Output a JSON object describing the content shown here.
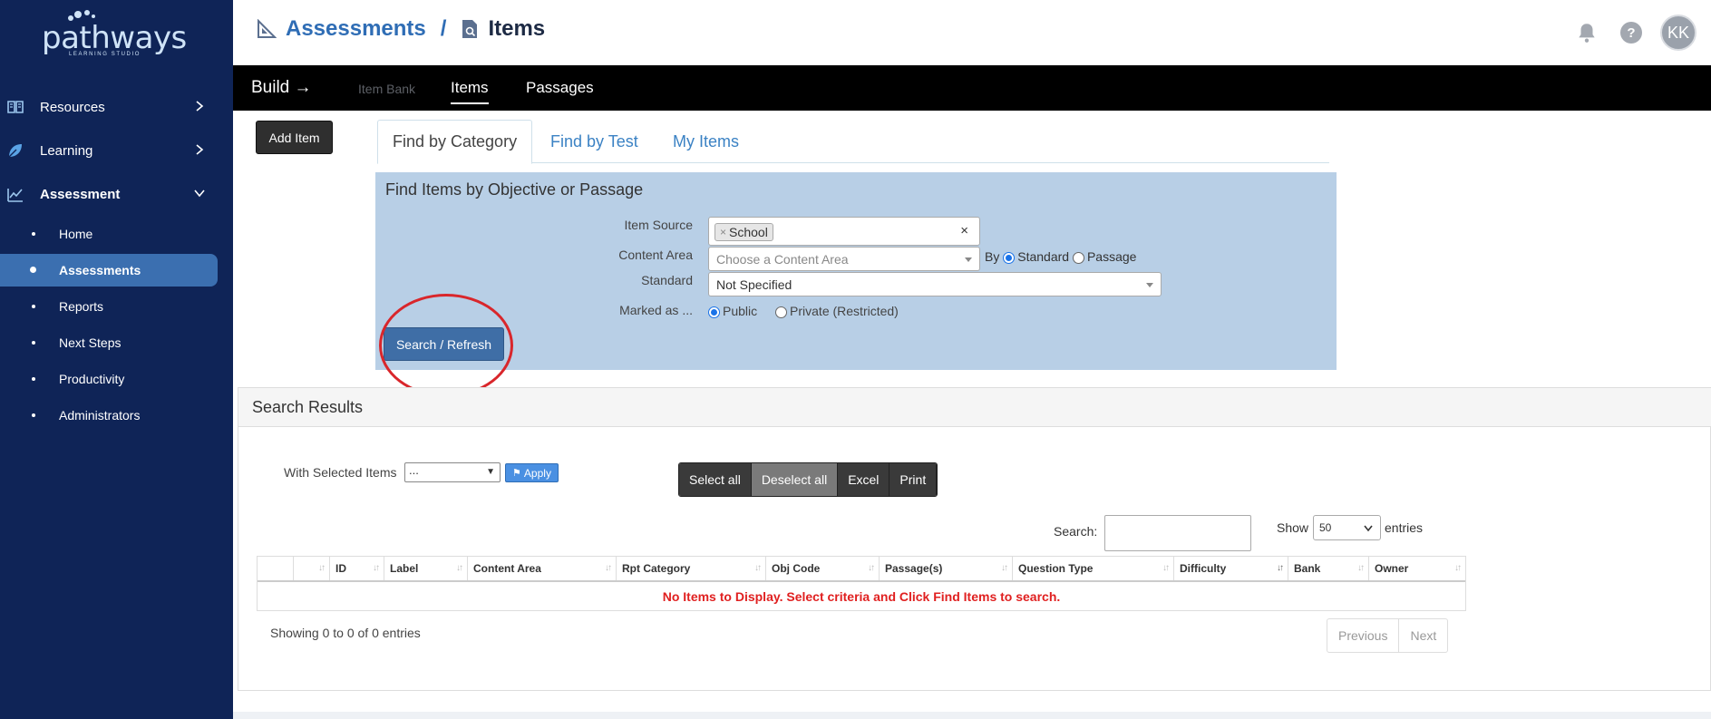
{
  "logo": {
    "word": "pathways",
    "sub": "LEARNING STUDIO"
  },
  "sidebar": {
    "main": [
      {
        "label": "Resources",
        "icon": "book-icon"
      },
      {
        "label": "Learning",
        "icon": "leaf-icon"
      },
      {
        "label": "Assessment",
        "icon": "chart-icon"
      }
    ],
    "sub": [
      "Home",
      "Assessments",
      "Reports",
      "Next Steps",
      "Productivity",
      "Administrators"
    ],
    "active_sub": "Assessments"
  },
  "header": {
    "crumb_parent": "Assessments",
    "crumb_sep": "/",
    "crumb_current": "Items",
    "avatar": "KK",
    "help": "?"
  },
  "buildbar": {
    "build": "Build →",
    "item_bank": "Item Bank",
    "items": "Items",
    "passages": "Passages"
  },
  "add_item": "Add Item",
  "tabs": [
    "Find by Category",
    "Find by Test",
    "My Items"
  ],
  "find": {
    "title": "Find Items by Objective or Passage",
    "item_source_label": "Item Source",
    "item_source_chip": "School",
    "clear": "×",
    "chip_remove": "×",
    "content_area_label": "Content Area",
    "content_area_placeholder": "Choose a Content Area",
    "by": "By",
    "by_standard": "Standard",
    "by_passage": "Passage",
    "standard_label": "Standard",
    "standard_value": "Not Specified",
    "marked_label": "Marked as ...",
    "public": "Public",
    "private": "Private (Restricted)",
    "search_button": "Search / Refresh"
  },
  "results": {
    "title": "Search Results",
    "with_selected": "With Selected Items",
    "with_selected_value": "...",
    "apply": "Apply",
    "buttons": [
      "Select all",
      "Deselect all",
      "Excel",
      "Print"
    ],
    "search_label": "Search:",
    "show_label": "Show",
    "show_value": "50",
    "entries_label": "entries",
    "columns": [
      "",
      "",
      "ID",
      "Label",
      "Content Area",
      "Rpt Category",
      "Obj Code",
      "Passage(s)",
      "Question Type",
      "Difficulty",
      "Bank",
      "Owner"
    ],
    "empty_message": "No Items to Display. Select criteria and Click Find Items to search.",
    "showing": "Showing 0 to 0 of 0 entries",
    "previous": "Previous",
    "next": "Next"
  },
  "colors": {
    "sidebar": "#0f2457",
    "active": "#3b6fb0",
    "accent": "#2f6db5",
    "highlight_circle": "#d9262b"
  }
}
